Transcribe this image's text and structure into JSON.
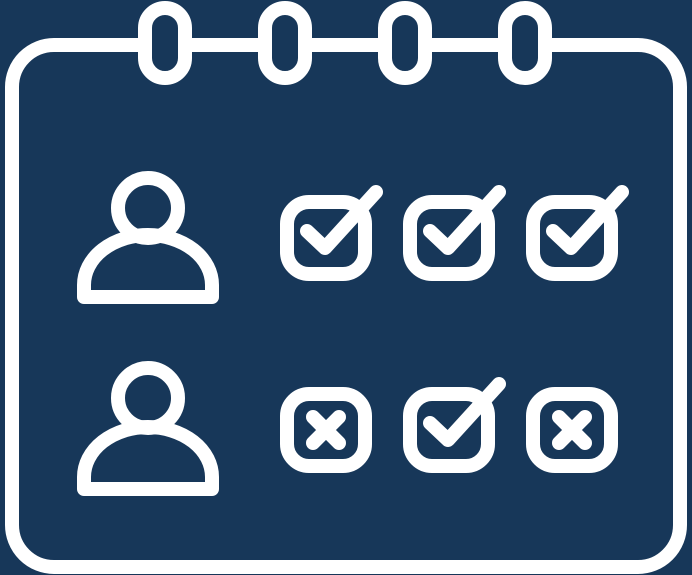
{
  "colors": {
    "background": "#173759",
    "stroke": "#ffffff"
  },
  "icon": {
    "name": "attendance-calendar-icon",
    "rows": [
      {
        "person_icon": "user-icon",
        "marks": [
          "check",
          "check",
          "check"
        ]
      },
      {
        "person_icon": "user-icon",
        "marks": [
          "cross",
          "check",
          "cross"
        ]
      }
    ]
  }
}
